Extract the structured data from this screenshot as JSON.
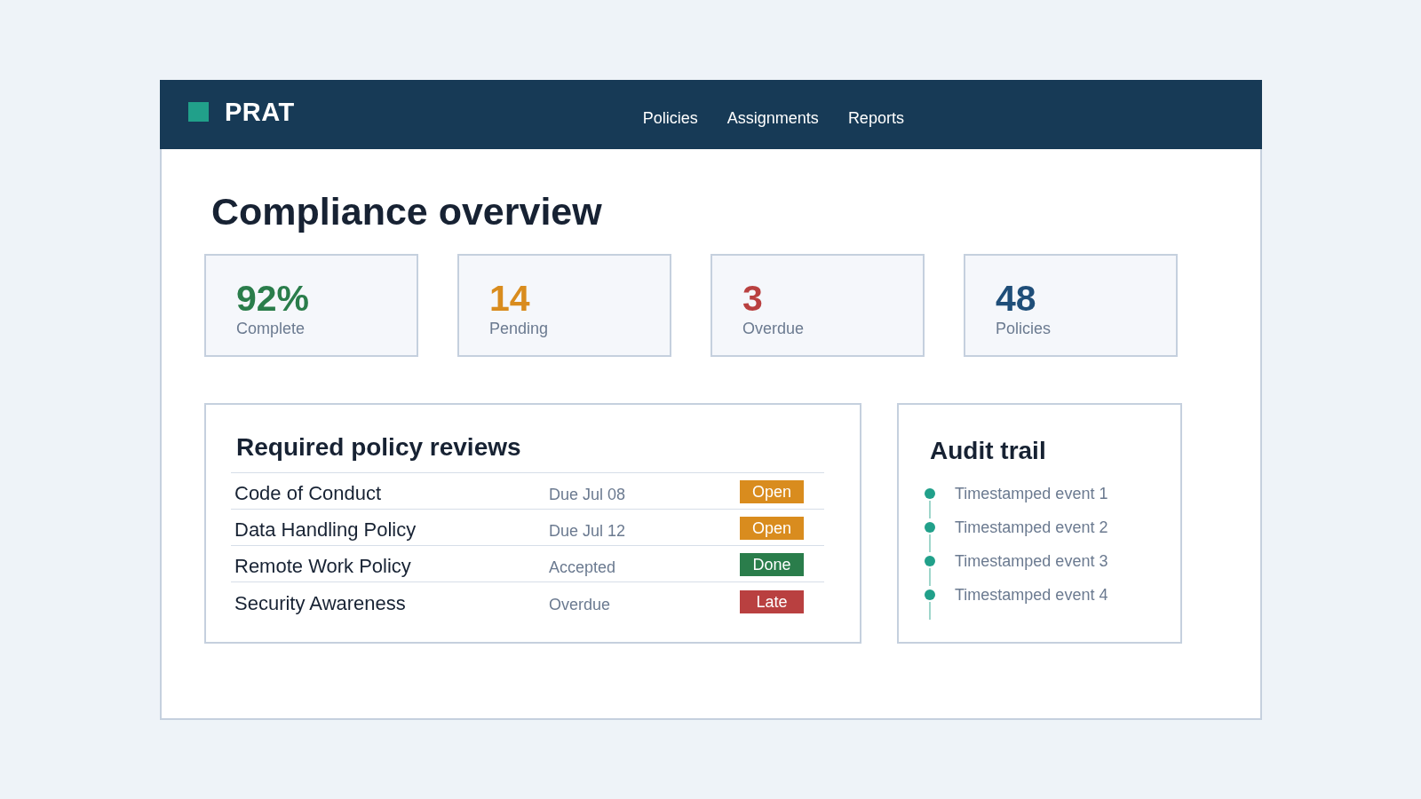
{
  "header": {
    "brand": "PRAT",
    "nav": [
      "Policies",
      "Assignments",
      "Reports"
    ]
  },
  "page_title": "Compliance overview",
  "stats": [
    {
      "value": "92%",
      "label": "Complete",
      "color": "#2a7d4b"
    },
    {
      "value": "14",
      "label": "Pending",
      "color": "#d98c1e"
    },
    {
      "value": "3",
      "label": "Overdue",
      "color": "#b94040"
    },
    {
      "value": "48",
      "label": "Policies",
      "color": "#1f4e79"
    }
  ],
  "reviews": {
    "title": "Required policy reviews",
    "rows": [
      {
        "name": "Code of Conduct",
        "detail": "Due Jul 08",
        "status": {
          "label": "Open",
          "color": "#d98c1e"
        }
      },
      {
        "name": "Data Handling Policy",
        "detail": "Due Jul 12",
        "status": {
          "label": "Open",
          "color": "#d98c1e"
        }
      },
      {
        "name": "Remote Work Policy",
        "detail": "Accepted",
        "status": {
          "label": "Done",
          "color": "#2a7d4b"
        }
      },
      {
        "name": "Security Awareness",
        "detail": "Overdue",
        "status": {
          "label": "Late",
          "color": "#b94040"
        }
      }
    ]
  },
  "audit_trail": {
    "title": "Audit trail",
    "events": [
      "Timestamped event 1",
      "Timestamped event 2",
      "Timestamped event 3",
      "Timestamped event 4"
    ]
  }
}
